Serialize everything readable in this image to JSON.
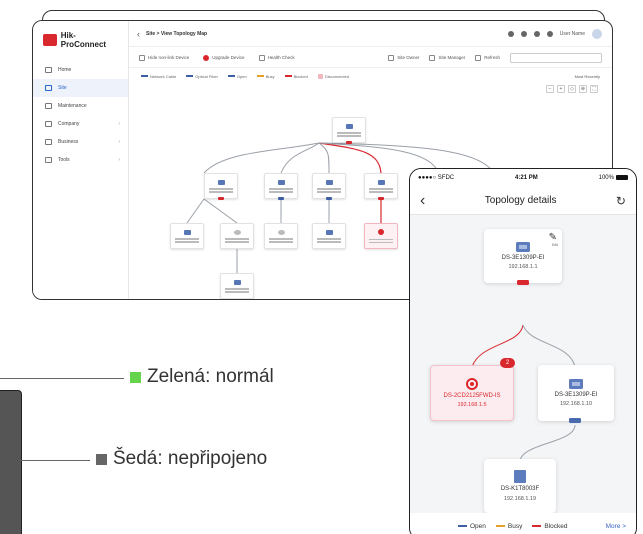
{
  "desktop": {
    "brand": "Hik-ProConnect",
    "breadcrumb": "Site > View Topology Map",
    "user": "User Name",
    "nav": [
      {
        "label": "Home",
        "icon": "home-icon"
      },
      {
        "label": "Site",
        "icon": "site-icon"
      },
      {
        "label": "Maintenance",
        "icon": "maintenance-icon"
      },
      {
        "label": "Company",
        "icon": "company-icon"
      },
      {
        "label": "Business",
        "icon": "business-icon"
      },
      {
        "label": "Tools",
        "icon": "tools-icon"
      }
    ],
    "toolbar": {
      "hide": "Hide non-link Device",
      "upgrade": "Upgrade Device",
      "health": "Health Check",
      "site_owner": "Site Owner",
      "site_manager": "Site Manager",
      "refresh": "Refresh"
    },
    "legend": {
      "network": "Network Cable",
      "optical": "Optical Fiber",
      "open": "Open",
      "busy": "Busy",
      "blocked": "Blocked",
      "disconnected": "Disconnected",
      "right": "Most Recently"
    }
  },
  "labels": {
    "green": "Zelená: normál",
    "gray": "Šedá: nepřipojeno"
  },
  "phone": {
    "status_carrier": "●●●●○ SFDC",
    "status_time": "4:21 PM",
    "status_battery": "100%",
    "title": "Topology details",
    "nodes": {
      "root": {
        "name": "DS-3E1309P-EI",
        "ip": "192.168.1.1"
      },
      "alert": {
        "name": "DS-2CD2125FWD-IS",
        "ip": "192.168.1.5",
        "badge": "2"
      },
      "switch2": {
        "name": "DS-3E1309P-EI",
        "ip": "192.168.1.10"
      },
      "pc": {
        "name": "DS-K1T8003F",
        "ip": "192.168.1.19"
      }
    },
    "edit_label": "Edit",
    "legend": {
      "open": "Open",
      "busy": "Busy",
      "blocked": "Blocked",
      "more": "More >"
    },
    "colors": {
      "open": "#3d5fa8",
      "busy": "#e6a12b",
      "blocked": "#d9272e"
    }
  }
}
